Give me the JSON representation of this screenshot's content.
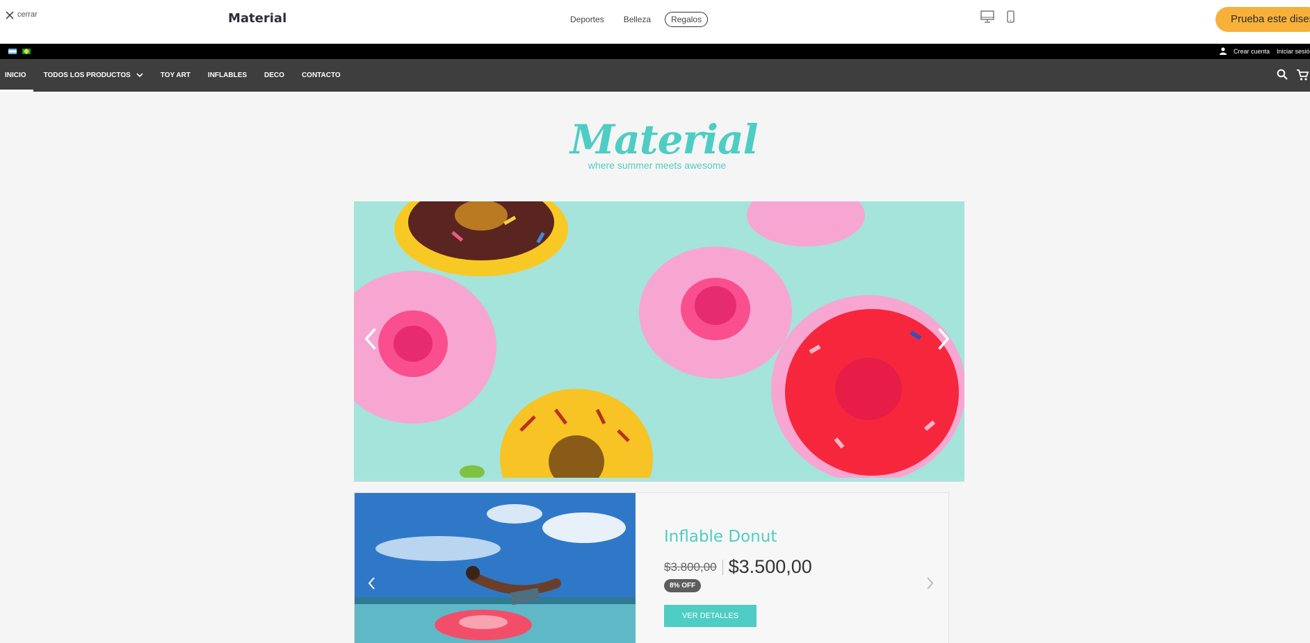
{
  "topbar": {
    "close_label": "cerrar",
    "brand": "Material",
    "categories": [
      "Deportes",
      "Belleza",
      "Regalos"
    ],
    "active_category": "Regalos",
    "cta_label": "Prueba este diseño",
    "cta_color": "#f7b13a"
  },
  "store": {
    "account": {
      "create": "Crear cuenta",
      "login": "Iniciar sesión"
    },
    "nav": [
      {
        "label": "INICIO",
        "active": true
      },
      {
        "label": "TODOS LOS PRODUCTOS",
        "has_dropdown": true
      },
      {
        "label": "TOY ART"
      },
      {
        "label": "INFLABLES"
      },
      {
        "label": "DECO"
      },
      {
        "label": "CONTACTO"
      }
    ],
    "cart_count": "0",
    "logo_text": "Material",
    "tagline": "where summer meets awesome",
    "accent_color": "#4ecdc4",
    "nav_bg": "#3e3e3e"
  },
  "product": {
    "name": "Inflable Donut",
    "old_price": "$3.800,00",
    "price": "$3.500,00",
    "discount": "8% OFF",
    "button": "VER DETALLES"
  }
}
